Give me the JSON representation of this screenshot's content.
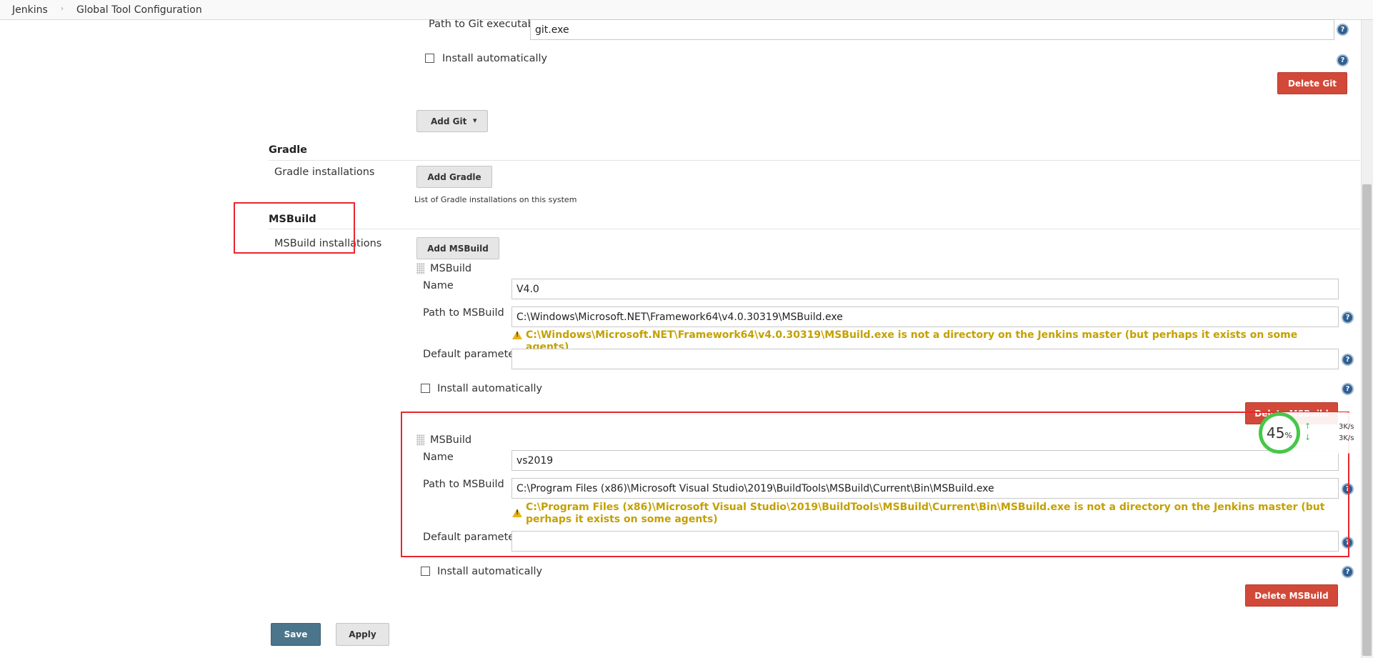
{
  "breadcrumb": {
    "items": [
      "Jenkins",
      "Global Tool Configuration"
    ],
    "separator": "›"
  },
  "git": {
    "path_label": "Path to Git executable",
    "path_value": "git.exe",
    "install_label": "Install automatically",
    "delete_label": "Delete Git",
    "add_label": "Add Git"
  },
  "gradle": {
    "title": "Gradle",
    "installations_label": "Gradle installations",
    "add_label": "Add Gradle",
    "note": "List of Gradle installations on this system"
  },
  "msbuild": {
    "title": "MSBuild",
    "installations_label": "MSBuild installations",
    "add_label": "Add MSBuild",
    "entries": [
      {
        "header": "MSBuild",
        "name_label": "Name",
        "name_value": "V4.0",
        "path_label": "Path to MSBuild",
        "path_value": "C:\\Windows\\Microsoft.NET\\Framework64\\v4.0.30319\\MSBuild.exe",
        "warning": "C:\\Windows\\Microsoft.NET\\Framework64\\v4.0.30319\\MSBuild.exe is not a directory on the Jenkins master (but perhaps it exists on some agents)",
        "params_label": "Default parameters",
        "params_value": "",
        "install_label": "Install automatically",
        "delete_label": "Delete MSBuild"
      },
      {
        "header": "MSBuild",
        "name_label": "Name",
        "name_value": "vs2019",
        "path_label": "Path to MSBuild",
        "path_value": "C:\\Program Files (x86)\\Microsoft Visual Studio\\2019\\BuildTools\\MSBuild\\Current\\Bin\\MSBuild.exe",
        "warning": "C:\\Program Files (x86)\\Microsoft Visual Studio\\2019\\BuildTools\\MSBuild\\Current\\Bin\\MSBuild.exe is not a directory on the Jenkins master (but perhaps it exists on some agents)",
        "params_label": "Default parameters",
        "params_value": "",
        "install_label": "Install automatically",
        "delete_label": "Delete MSBuild"
      }
    ]
  },
  "footer": {
    "save_label": "Save",
    "apply_label": "Apply"
  },
  "help_glyph": "?",
  "dropdown_glyph": "▾",
  "network_widget": {
    "percent": "45",
    "percent_unit": "%",
    "upload_rate": "3K/s",
    "download_rate": "3K/s",
    "upload_arrow": "↑",
    "download_arrow": "↓"
  },
  "colors": {
    "danger": "#d24939",
    "primary": "#4b758b",
    "warning_text": "#c4a000",
    "annotation_box": "#e8262d",
    "widget_ring": "#46c74a"
  }
}
